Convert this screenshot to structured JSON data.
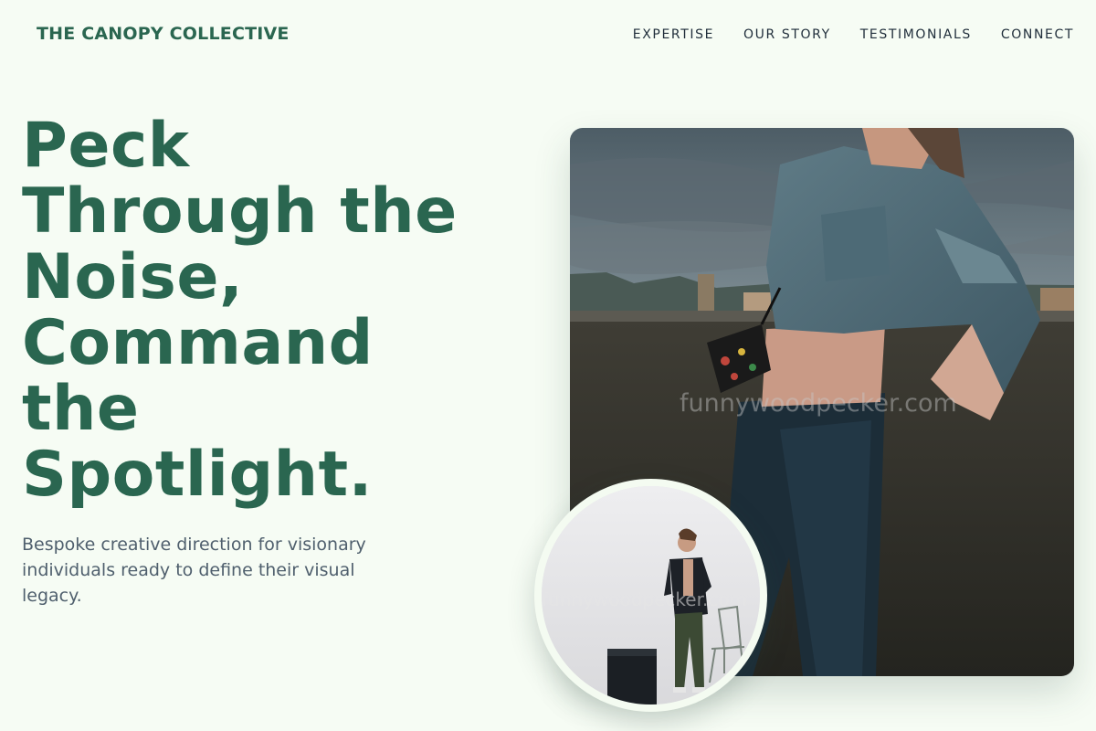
{
  "header": {
    "brand": "THE CANOPY COLLECTIVE",
    "nav": [
      "EXPERTISE",
      "OUR STORY",
      "TESTIMONIALS",
      "CONNECT"
    ]
  },
  "hero": {
    "title_lines": [
      "Peck",
      "Through the",
      "Noise,",
      "Command",
      "the",
      "Spotlight."
    ],
    "subtitle": "Bespoke creative direction for visionary individuals ready to define their visual legacy."
  },
  "images": {
    "main_watermark": "funnywoodpecker.com",
    "circle_watermark": "funnywoodpecker.com"
  },
  "colors": {
    "background": "#f6fcf4",
    "brand_green": "#2a6650",
    "nav_text": "#1f2d3a",
    "subtitle_text": "#4f5f6d"
  }
}
